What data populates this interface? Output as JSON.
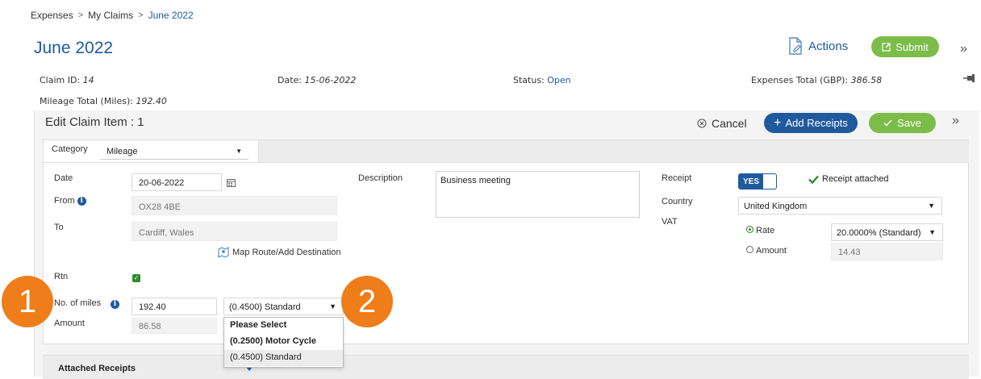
{
  "breadcrumb": {
    "items": [
      "Expenses",
      "My Claims",
      "June 2022"
    ],
    "sep": ">"
  },
  "header": {
    "title": "June 2022",
    "actions_label": "Actions",
    "submit_label": "Submit",
    "expand_glyph": "»"
  },
  "claim": {
    "id_label": "Claim ID:",
    "id_value": "14",
    "date_label": "Date:",
    "date_value": "15-06-2022",
    "status_label": "Status:",
    "status_value": "Open",
    "total_label": "Expenses Total (GBP):",
    "total_value": "386.58",
    "mileage_label": "Mileage Total (Miles):",
    "mileage_value": "192.40"
  },
  "edit": {
    "title": "Edit Claim Item : 1",
    "cancel_label": "Cancel",
    "add_receipts_label": "Add Receipts",
    "save_label": "Save",
    "expand_glyph": "»"
  },
  "category": {
    "label": "Category",
    "value": "Mileage"
  },
  "form": {
    "date_label": "Date",
    "date_value": "20-06-2022",
    "from_label": "From",
    "from_value": "OX28 4BE",
    "to_label": "To",
    "to_value": "Cardiff, Wales",
    "map_label": "Map Route/Add Destination",
    "rtn_label": "Rtn",
    "miles_label": "No. of miles",
    "miles_value": "192.40",
    "rate_value": "(0.4500) Standard",
    "amount_label": "Amount",
    "amount_value": "86.58",
    "description_label": "Description",
    "description_value": "Business meeting",
    "receipt_label": "Receipt",
    "receipt_toggle": "YES",
    "receipt_status": "Receipt attached",
    "country_label": "Country",
    "country_value": "United Kingdom",
    "vat_label": "VAT",
    "vat_rate_label": "Rate",
    "vat_rate_value": "20.0000% (Standard)",
    "vat_amount_label": "Amount",
    "vat_amount_value": "14.43"
  },
  "dropdown": {
    "options": [
      "Please Select",
      "(0.2500) Motor Cycle",
      "(0.4500) Standard"
    ]
  },
  "badges": [
    "1",
    "2"
  ],
  "attached": {
    "label": "Attached Receipts"
  },
  "colors": {
    "brand_blue": "#1f5a9e",
    "accent_green": "#7cbd49",
    "callout_orange": "#ef7d1a"
  }
}
